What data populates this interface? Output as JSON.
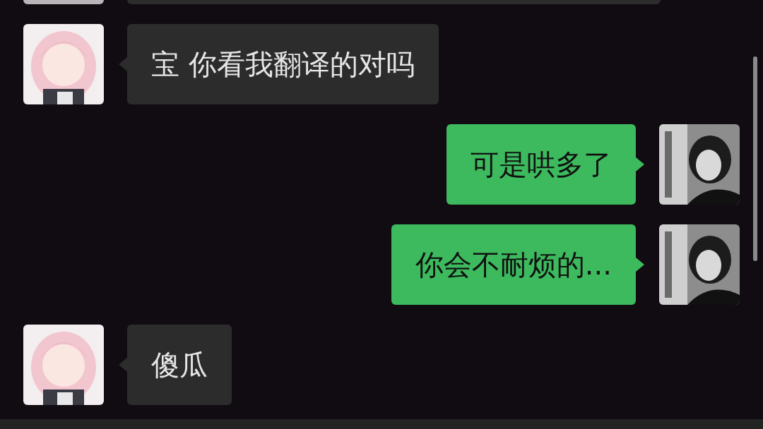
{
  "messages": [
    {
      "kind": "partial",
      "outgoing": false
    },
    {
      "kind": "text",
      "outgoing": false,
      "text": "宝 你看我翻译的对吗"
    },
    {
      "kind": "text",
      "outgoing": true,
      "text": "可是哄多了"
    },
    {
      "kind": "text",
      "outgoing": true,
      "text": "你会不耐烦的..."
    },
    {
      "kind": "text",
      "outgoing": false,
      "text": "傻瓜"
    }
  ]
}
